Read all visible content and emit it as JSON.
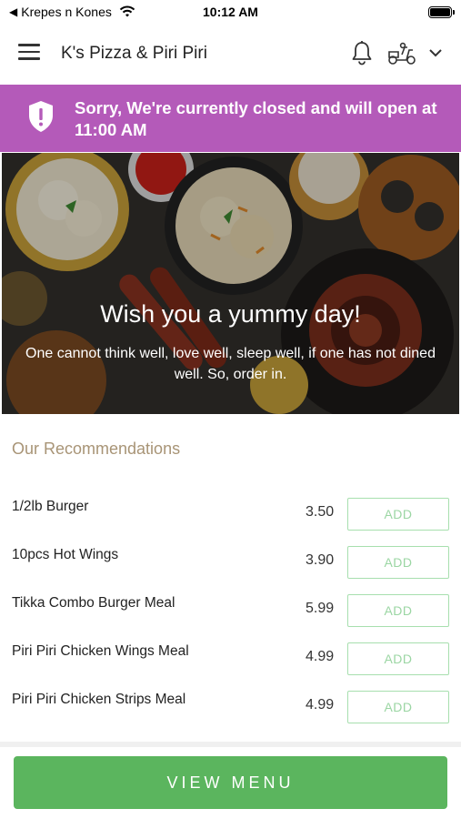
{
  "status_bar": {
    "back_app": "Krepes n Kones",
    "time": "10:12 AM"
  },
  "header": {
    "store_name": "K's Pizza & Piri Piri",
    "icons": [
      "menu-icon",
      "bell-icon",
      "delivery-scooter-icon",
      "chevron-down-icon"
    ]
  },
  "banner": {
    "message": "Sorry, We're currently closed and will open at 11:00 AM",
    "color": "#b45ab9",
    "icon": "shield-alert-icon"
  },
  "hero": {
    "title": "Wish you a yummy day!",
    "subtitle": "One cannot think well, love well, sleep well, if one has not dined well. So, order in."
  },
  "recommendations": {
    "title": "Our Recommendations",
    "items": [
      {
        "name": "1/2lb Burger",
        "price": "3.50",
        "add_label": "ADD"
      },
      {
        "name": "10pcs Hot Wings",
        "price": "3.90",
        "add_label": "ADD"
      },
      {
        "name": "Tikka Combo Burger Meal",
        "price": "5.99",
        "add_label": "ADD"
      },
      {
        "name": "Piri Piri Chicken Wings Meal",
        "price": "4.99",
        "add_label": "ADD"
      },
      {
        "name": "Piri Piri Chicken Strips Meal",
        "price": "4.99",
        "add_label": "ADD"
      }
    ]
  },
  "footer": {
    "view_menu_label": "VIEW MENU",
    "accent": "#5bb55e"
  }
}
